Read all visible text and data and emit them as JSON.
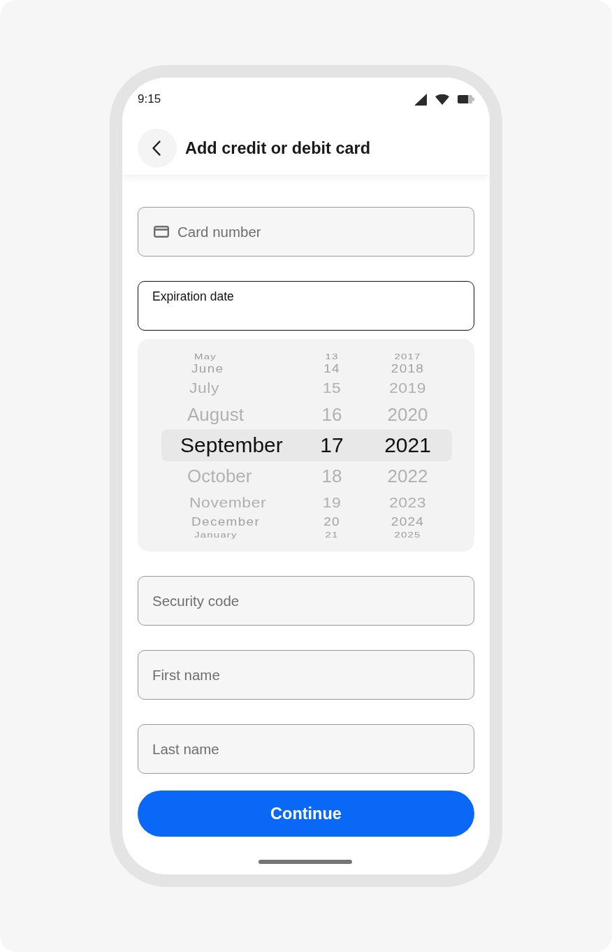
{
  "status_bar": {
    "time": "9:15"
  },
  "header": {
    "title": "Add credit or debit card"
  },
  "form": {
    "fields": [
      {
        "kind": "card",
        "placeholder": "Card number",
        "focused": false
      },
      {
        "kind": "date",
        "label": "Expiration date",
        "focused": true,
        "picker": {
          "rows": [
            {
              "month": "May",
              "day": "13",
              "year": "2017",
              "selected": false
            },
            {
              "month": "June",
              "day": "14",
              "year": "2018",
              "selected": false
            },
            {
              "month": "July",
              "day": "15",
              "year": "2019",
              "selected": false
            },
            {
              "month": "August",
              "day": "16",
              "year": "2020",
              "selected": false
            },
            {
              "month": "September",
              "day": "17",
              "year": "2021",
              "selected": true
            },
            {
              "month": "October",
              "day": "18",
              "year": "2022",
              "selected": false
            },
            {
              "month": "November",
              "day": "19",
              "year": "2023",
              "selected": false
            },
            {
              "month": "December",
              "day": "20",
              "year": "2024",
              "selected": false
            },
            {
              "month": "January",
              "day": "21",
              "year": "2025",
              "selected": false
            }
          ]
        }
      },
      {
        "kind": "input",
        "placeholder": "Security code",
        "focused": false
      },
      {
        "kind": "input",
        "placeholder": "First name",
        "focused": false
      },
      {
        "kind": "input",
        "placeholder": "Last name",
        "focused": false
      }
    ],
    "button": {
      "label": "Continue"
    }
  }
}
